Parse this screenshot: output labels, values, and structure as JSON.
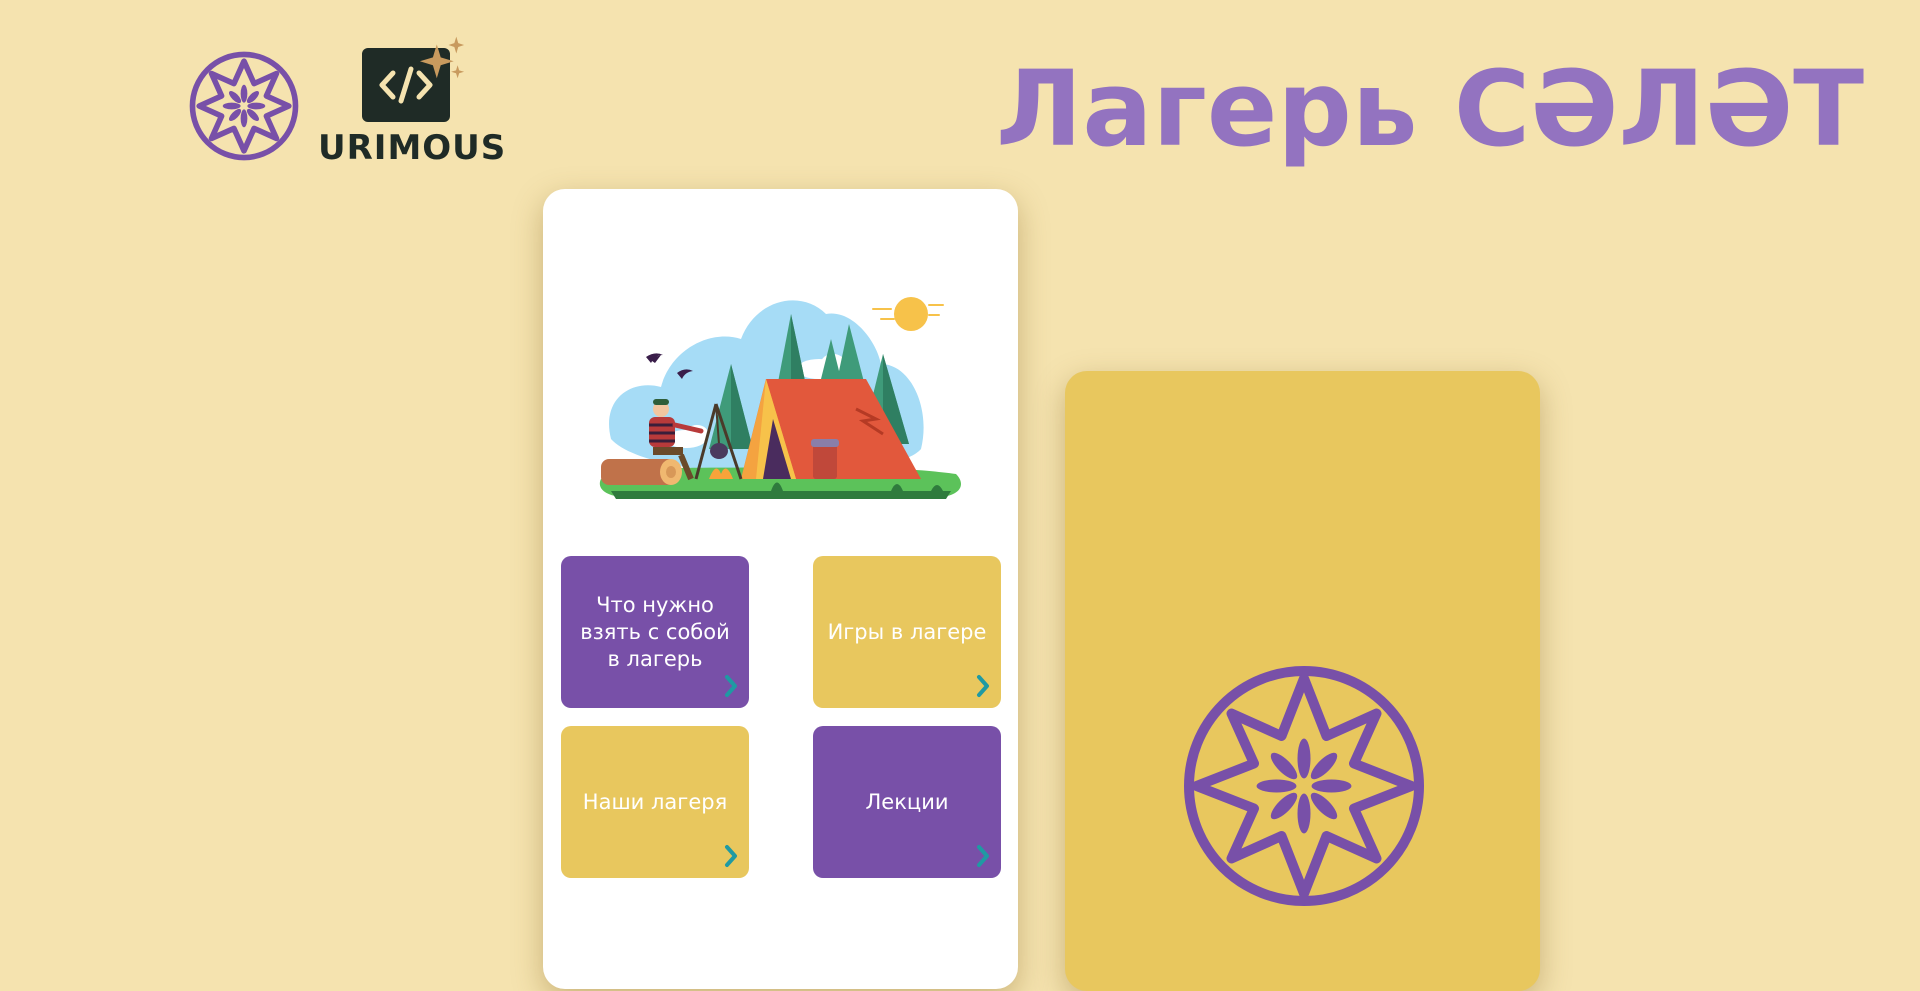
{
  "header": {
    "title": "Лагерь СӘЛӘТ",
    "logo_urimous_text": "URIMOUS",
    "logo_salat_icon": "salat-emblem-icon",
    "logo_urimous_icon": "code-brackets-icon"
  },
  "menu": {
    "tiles": [
      {
        "label": "Что нужно взять с собой в лагерь",
        "color": "#7850A8"
      },
      {
        "label": "Игры в лагере",
        "color": "#E8C75E"
      },
      {
        "label": "Наши лагеря",
        "color": "#E8C75E"
      },
      {
        "label": "Лекции",
        "color": "#7850A8"
      }
    ],
    "chevron_icon": "chevron-right-icon",
    "chevron_color": "#1F9AA3"
  },
  "colors": {
    "background": "#F5E3AF",
    "accent_purple": "#7850A8",
    "title_purple": "#9373C0",
    "accent_yellow": "#E8C75E"
  }
}
